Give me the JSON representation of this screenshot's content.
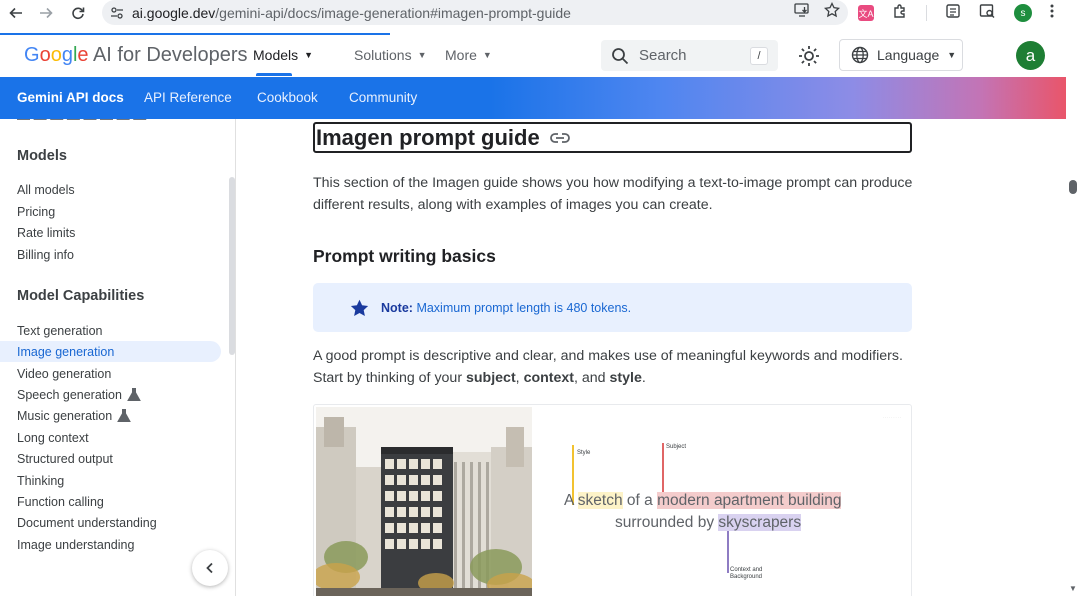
{
  "browser": {
    "url_host": "ai.google.dev",
    "url_path": "/gemini-api/docs/image-generation#imagen-prompt-guide",
    "profile_initial": "s",
    "translate_glyph": "文A"
  },
  "header": {
    "logo_google": [
      "G",
      "o",
      "o",
      "g",
      "l",
      "e"
    ],
    "logo_rest": " AI for Developers",
    "nav": [
      {
        "label": "Models"
      },
      {
        "label": "Solutions"
      },
      {
        "label": "More"
      }
    ],
    "search_placeholder": "Search",
    "search_shortcut": "/",
    "language_label": "Language",
    "avatar_initial": "a"
  },
  "tabs": [
    {
      "label": "Gemini API docs"
    },
    {
      "label": "API Reference"
    },
    {
      "label": "Cookbook"
    },
    {
      "label": "Community"
    }
  ],
  "sidebar": {
    "sections": [
      {
        "heading": "Models",
        "items": [
          "All models",
          "Pricing",
          "Rate limits",
          "Billing info"
        ]
      },
      {
        "heading": "Model Capabilities",
        "items": [
          "Text generation",
          "Image generation",
          "Video generation",
          "Speech generation",
          "Music generation",
          "Long context",
          "Structured output",
          "Thinking",
          "Function calling",
          "Document understanding",
          "Image understanding"
        ]
      }
    ],
    "active_item": "Image generation",
    "experimental_items": [
      "Speech generation",
      "Music generation"
    ]
  },
  "content": {
    "title": "Imagen prompt guide",
    "intro": "This section of the Imagen guide shows you how modifying a text-to-image prompt can produce different results, along with examples of images you can create.",
    "h2": "Prompt writing basics",
    "note_label": "Note:",
    "note_text": "Maximum prompt length is 480 tokens.",
    "body_prefix": "A good prompt is descriptive and clear, and makes use of meaningful keywords and modifiers. Start by thinking of your ",
    "body_subject": "subject",
    "body_sep1": ", ",
    "body_context": "context",
    "body_sep2": ", and ",
    "body_style": "style",
    "body_end": "."
  },
  "figure": {
    "prompt_a": "A ",
    "prompt_sketch": "sketch",
    "prompt_of": " of a ",
    "prompt_subject": "modern apartment building",
    "prompt_surrounded": "surrounded by ",
    "prompt_skyscrapers": "skyscrapers",
    "label_style": "Style",
    "label_subject": "Subject",
    "label_context": "Context and\nBackground",
    "colors": {
      "style": "#f2c230",
      "subject": "#e06666",
      "context": "#8e7cc3"
    }
  }
}
